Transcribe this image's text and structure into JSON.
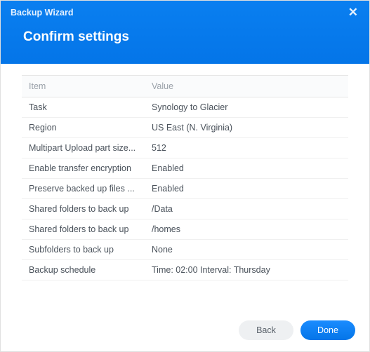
{
  "header": {
    "wizard_title": "Backup Wizard",
    "page_title": "Confirm settings"
  },
  "columns": {
    "item": "Item",
    "value": "Value"
  },
  "rows": [
    {
      "item": "Task",
      "value": "Synology to Glacier"
    },
    {
      "item": "Region",
      "value": "US East (N. Virginia)"
    },
    {
      "item": "Multipart Upload part size...",
      "value": "512"
    },
    {
      "item": "Enable transfer encryption",
      "value": "Enabled"
    },
    {
      "item": "Preserve backed up files ...",
      "value": "Enabled"
    },
    {
      "item": "Shared folders to back up",
      "value": "/Data"
    },
    {
      "item": "Shared folders to back up",
      "value": "/homes"
    },
    {
      "item": "Subfolders to back up",
      "value": "None"
    },
    {
      "item": "Backup schedule",
      "value": "Time: 02:00 Interval: Thursday"
    }
  ],
  "buttons": {
    "back": "Back",
    "done": "Done"
  },
  "close_glyph": "✕"
}
